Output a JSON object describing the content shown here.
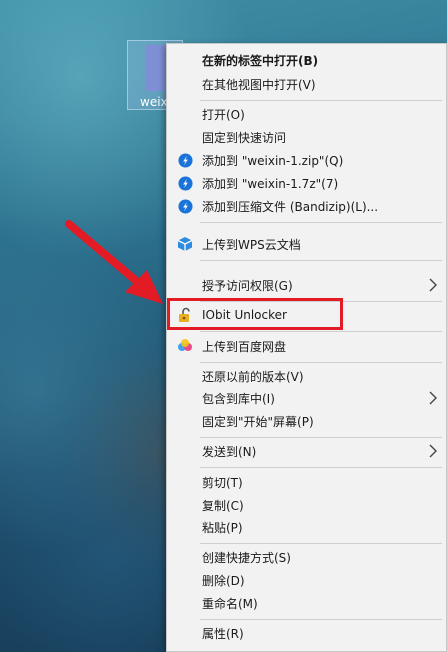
{
  "desktop": {
    "file_label": "weixin-1.7z"
  },
  "menu": {
    "open_in_new_tab": "在新的标签中打开(B)",
    "open_in_other_view": "在其他视图中打开(V)",
    "open": "打开(O)",
    "pin_quick_access": "固定到快速访问",
    "add_to_zip": "添加到 \"weixin-1.zip\"(Q)",
    "add_to_7z": "添加到 \"weixin-1.7z\"(7)",
    "add_to_archive": "添加到压缩文件 (Bandizip)(L)...",
    "upload_wps": "上传到WPS云文档",
    "grant_access": "授予访问权限(G)",
    "iobit_unlocker": "IObit Unlocker",
    "upload_baidu": "上传到百度网盘",
    "restore_versions": "还原以前的版本(V)",
    "include_library": "包含到库中(I)",
    "pin_start": "固定到\"开始\"屏幕(P)",
    "send_to": "发送到(N)",
    "cut": "剪切(T)",
    "copy": "复制(C)",
    "paste": "粘贴(P)",
    "create_shortcut": "创建快捷方式(S)",
    "delete": "删除(D)",
    "rename": "重命名(M)",
    "properties": "属性(R)"
  },
  "colors": {
    "menu_bg": "#f2f2f2",
    "highlight_red": "#e21b25",
    "bandizip_blue": "#1a73d9",
    "wps_blue": "#2d8be0"
  }
}
